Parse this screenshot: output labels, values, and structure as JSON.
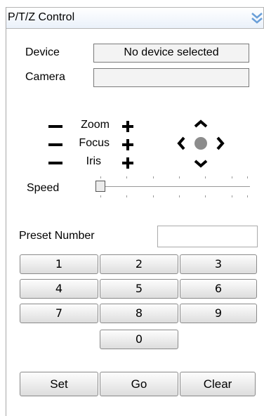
{
  "header": {
    "title": "P/T/Z Control",
    "collapse_icon": "double-chevron-down-icon"
  },
  "device": {
    "label": "Device",
    "value": "No device selected"
  },
  "camera": {
    "label": "Camera",
    "value": ""
  },
  "controls": {
    "zoom": "Zoom",
    "focus": "Focus",
    "iris": "Iris"
  },
  "speed": {
    "label": "Speed",
    "value": 0
  },
  "preset": {
    "label": "Preset Number",
    "value": "",
    "keys": [
      "1",
      "2",
      "3",
      "4",
      "5",
      "6",
      "7",
      "8",
      "9",
      "0"
    ]
  },
  "actions": {
    "set": "Set",
    "go": "Go",
    "clear": "Clear"
  }
}
